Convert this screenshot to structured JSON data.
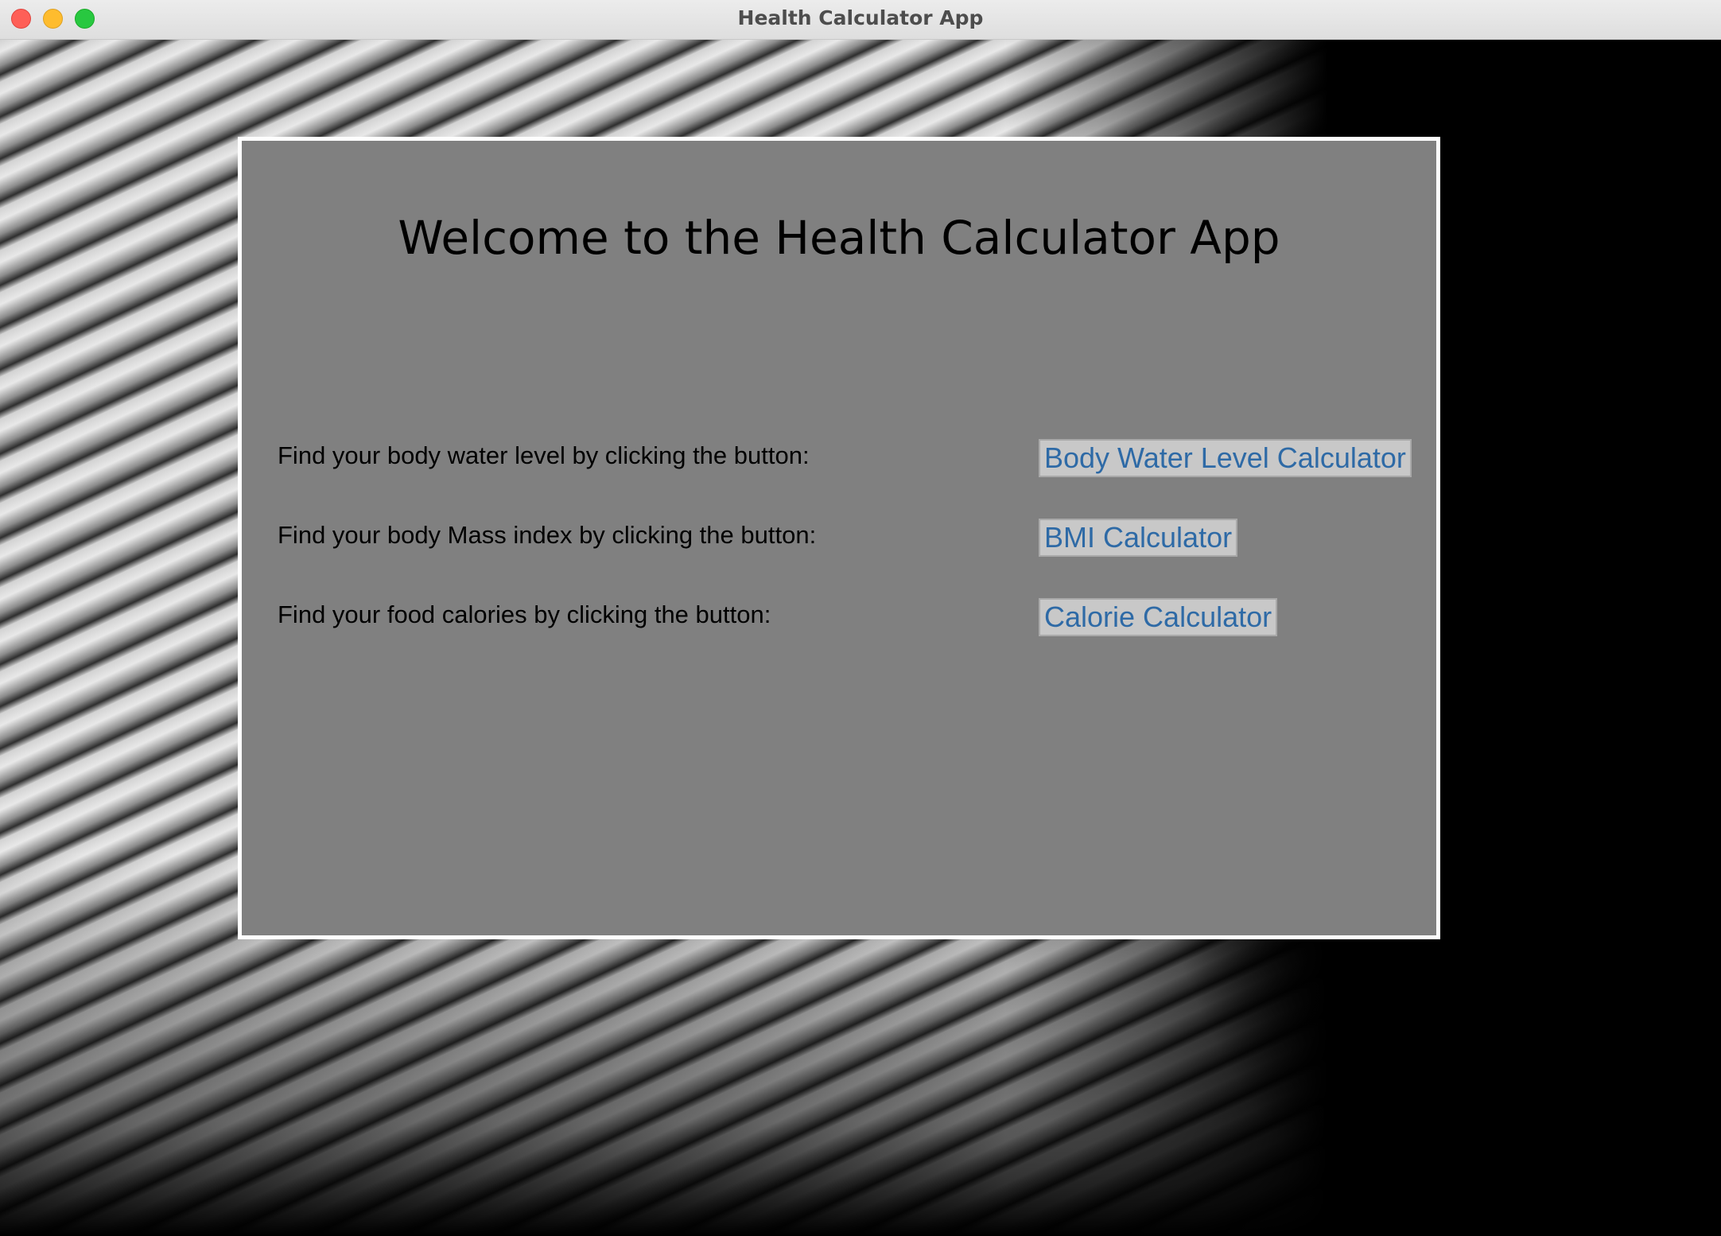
{
  "window": {
    "title": "Health Calculator App"
  },
  "main": {
    "heading": "Welcome to the Health Calculator App",
    "rows": [
      {
        "label": "Find your body water level by clicking the button:",
        "button_label": "Body Water Level Calculator"
      },
      {
        "label": "Find your body Mass index by clicking the button:",
        "button_label": "BMI Calculator"
      },
      {
        "label": "Find your food calories by clicking the button:",
        "button_label": "Calorie Calculator"
      }
    ]
  },
  "colors": {
    "panel_background": "#808080",
    "panel_border": "#ffffff",
    "button_text": "#2e6aa6",
    "button_background": "#c8c8c8"
  }
}
